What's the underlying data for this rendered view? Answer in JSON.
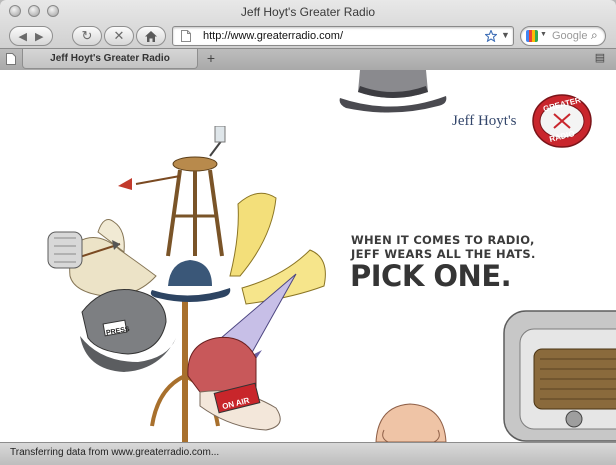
{
  "window": {
    "title": "Jeff Hoyt's Greater Radio"
  },
  "toolbar": {
    "url": "http://www.greaterradio.com/",
    "search_placeholder": "Google"
  },
  "tabs": [
    {
      "label": "Jeff Hoyt's Greater Radio"
    }
  ],
  "page": {
    "brand_name": "Jeff Hoyt's",
    "logo_text_top": "GREATER",
    "logo_text_bottom": "RADIO",
    "headline_line1": "WHEN IT COMES TO RADIO,",
    "headline_line2": "JEFF WEARS ALL THE HATS.",
    "headline_line3": "PICK ONE.",
    "on_air_sign": "ON AIR",
    "press_card": "PRESS"
  },
  "status": {
    "text": "Transferring data from www.greaterradio.com..."
  }
}
